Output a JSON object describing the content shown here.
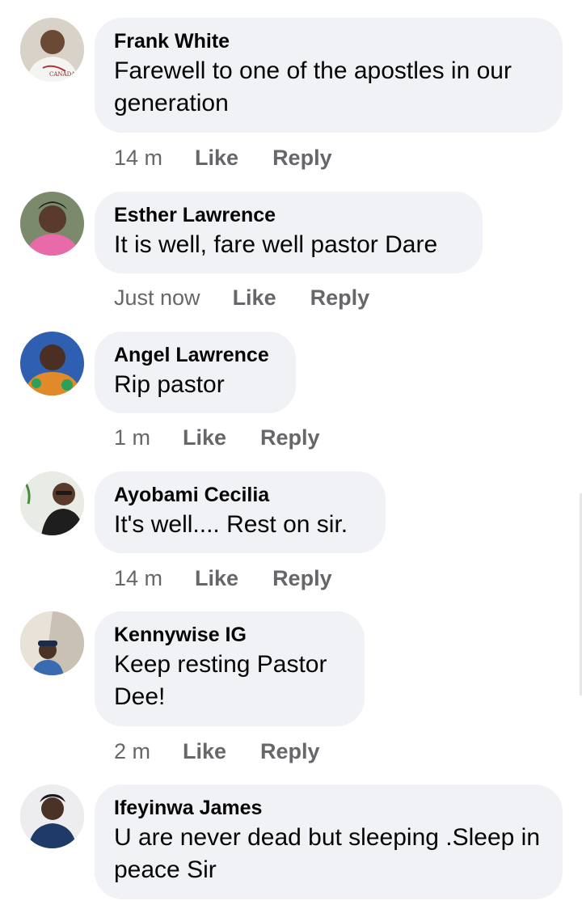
{
  "comments": [
    {
      "author": "Frank White",
      "text": "Farewell to one of the apostles in our generation",
      "time": "14 m",
      "like_label": "Like",
      "reply_label": "Reply",
      "avatar_badge": "CANADA"
    },
    {
      "author": "Esther Lawrence",
      "text": "It is well, fare well pastor Dare",
      "time": "Just now",
      "like_label": "Like",
      "reply_label": "Reply"
    },
    {
      "author": "Angel Lawrence",
      "text": "Rip pastor",
      "time": "1 m",
      "like_label": "Like",
      "reply_label": "Reply"
    },
    {
      "author": "Ayobami Cecilia",
      "text": "It's well.... Rest on sir.",
      "time": "14 m",
      "like_label": "Like",
      "reply_label": "Reply"
    },
    {
      "author": "Kennywise IG",
      "text": "Keep resting Pastor Dee!",
      "time": "2 m",
      "like_label": "Like",
      "reply_label": "Reply"
    },
    {
      "author": "Ifeyinwa James",
      "text": "U are never dead but sleeping .Sleep in peace Sir"
    }
  ],
  "colors": {
    "bubble": "#f0f2f5",
    "meta": "#65676b",
    "text": "#050505"
  }
}
